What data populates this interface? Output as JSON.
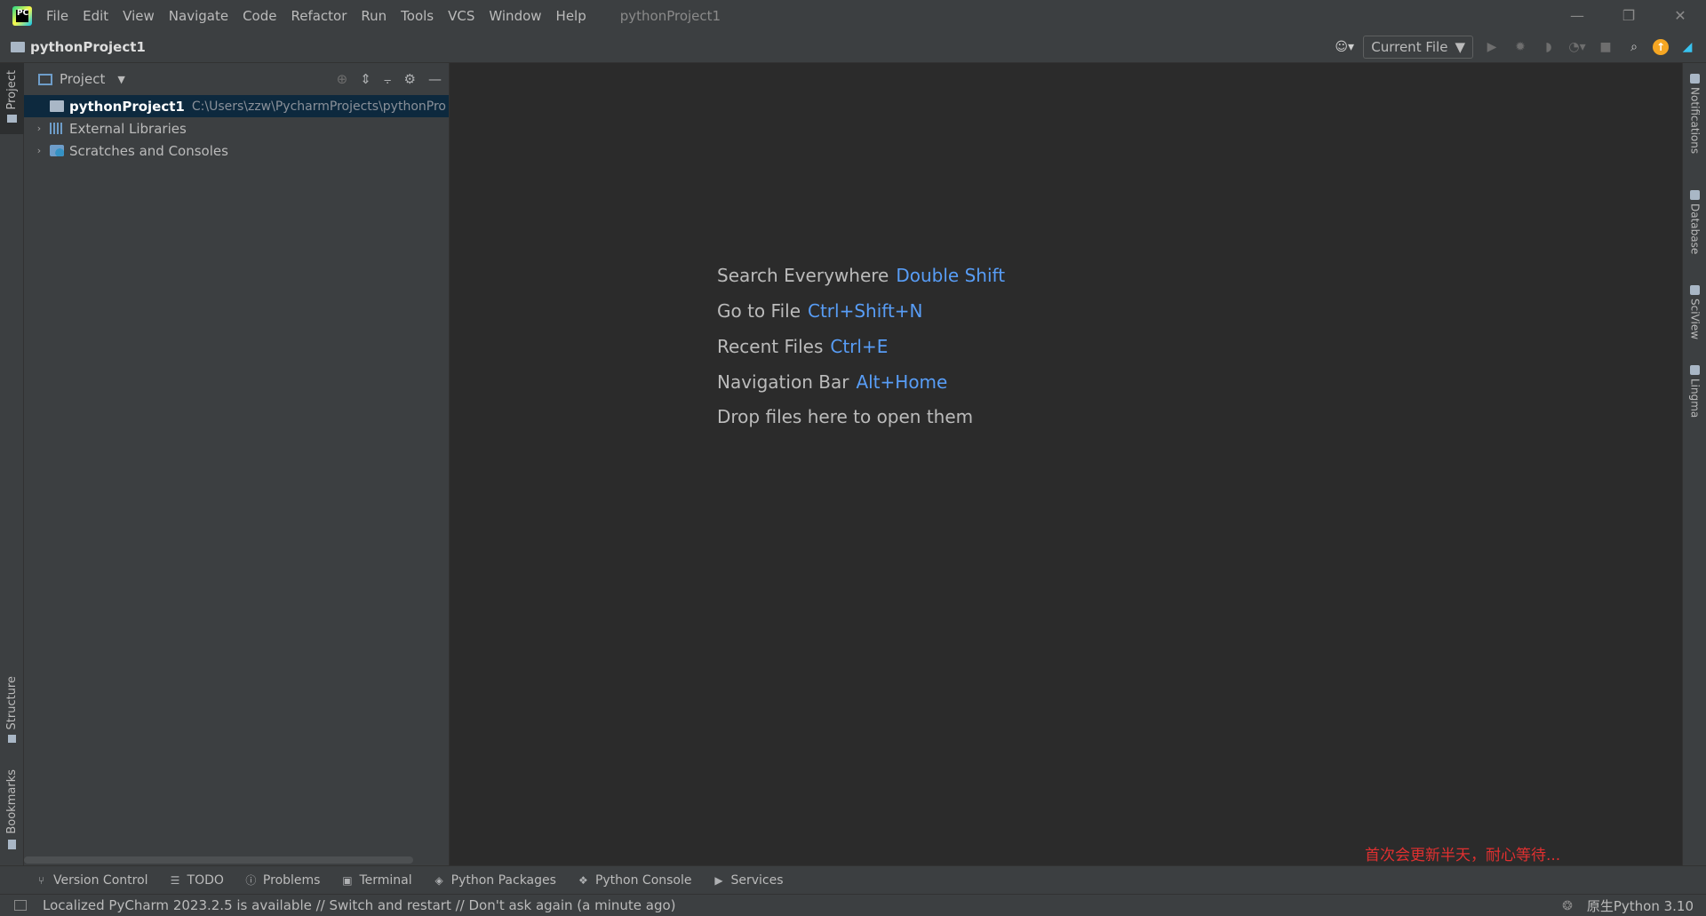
{
  "window": {
    "title": "pythonProject1",
    "controls": [
      "minimize",
      "restore",
      "close"
    ]
  },
  "menu": [
    {
      "label": "File"
    },
    {
      "label": "Edit"
    },
    {
      "label": "View"
    },
    {
      "label": "Navigate"
    },
    {
      "label": "Code"
    },
    {
      "label": "Refactor"
    },
    {
      "label": "Run"
    },
    {
      "label": "Tools"
    },
    {
      "label": "VCS"
    },
    {
      "label": "Window"
    },
    {
      "label": "Help"
    }
  ],
  "navbar": {
    "project": "pythonProject1",
    "run_config": "Current File",
    "toolbar_icons": [
      "user-icon",
      "run-icon",
      "debug-icon",
      "coverage-icon",
      "profile-icon",
      "stop-icon",
      "search-icon",
      "update-icon",
      "plugin-icon"
    ]
  },
  "left_strip": {
    "project": "Project",
    "structure": "Structure",
    "bookmarks": "Bookmarks"
  },
  "project_panel": {
    "title": "Project",
    "tree": [
      {
        "label": "pythonProject1",
        "path": "C:\\Users\\zzw\\PycharmProjects\\pythonPro",
        "expandable": false,
        "selected": true,
        "icon": "folder-icon"
      },
      {
        "label": "External Libraries",
        "path": "",
        "expandable": true,
        "selected": false,
        "icon": "library-icon"
      },
      {
        "label": "Scratches and Consoles",
        "path": "",
        "expandable": true,
        "selected": false,
        "icon": "scratch-icon"
      }
    ]
  },
  "editor": {
    "hints": [
      {
        "text": "Search Everywhere",
        "shortcut": "Double Shift"
      },
      {
        "text": "Go to File",
        "shortcut": "Ctrl+Shift+N"
      },
      {
        "text": "Recent Files",
        "shortcut": "Ctrl+E"
      },
      {
        "text": "Navigation Bar",
        "shortcut": "Alt+Home"
      },
      {
        "text": "Drop files here to open them",
        "shortcut": ""
      }
    ],
    "notice": "首次会更新半天，耐心等待..."
  },
  "right_strip": {
    "notifications": "Notifications",
    "database": "Database",
    "sciview": "SciView",
    "lingma": "Lingma"
  },
  "bottom_tabs": [
    {
      "label": "Version Control",
      "icon": "branch-icon"
    },
    {
      "label": "TODO",
      "icon": "list-icon"
    },
    {
      "label": "Problems",
      "icon": "problems-icon"
    },
    {
      "label": "Terminal",
      "icon": "terminal-icon"
    },
    {
      "label": "Python Packages",
      "icon": "packages-icon"
    },
    {
      "label": "Python Console",
      "icon": "python-icon"
    },
    {
      "label": "Services",
      "icon": "services-icon"
    }
  ],
  "status": {
    "message": "Localized PyCharm 2023.2.5 is available // Switch and restart // Don't ask again (a minute ago)",
    "interpreter": "原生Python 3.10"
  }
}
